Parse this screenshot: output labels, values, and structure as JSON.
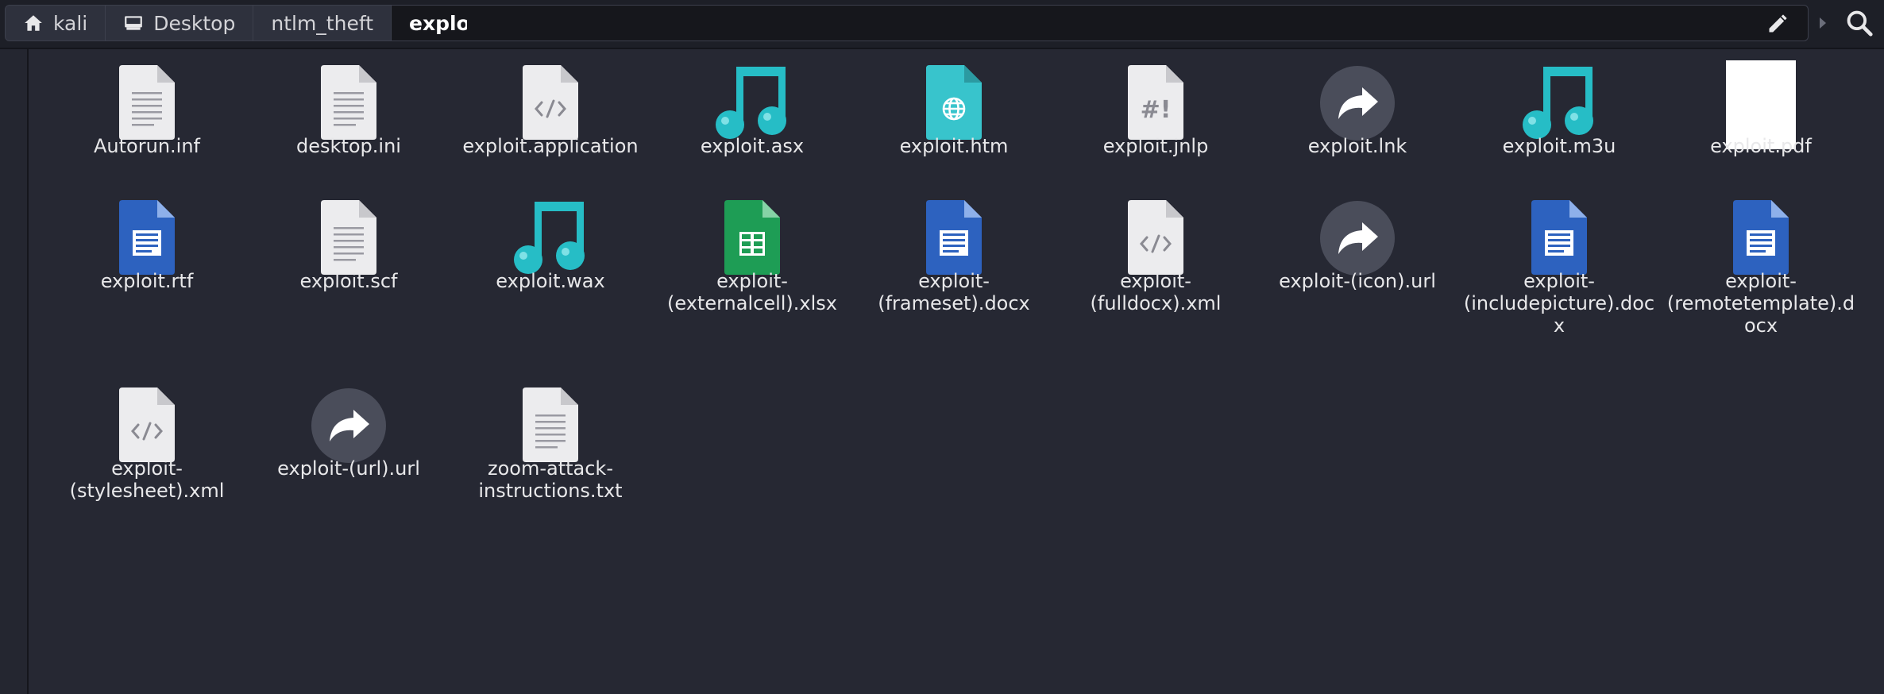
{
  "breadcrumbs": [
    {
      "label": "kali",
      "icon": "home-icon"
    },
    {
      "label": "Desktop",
      "icon": "desktop-icon"
    },
    {
      "label": "ntlm_theft",
      "icon": ""
    },
    {
      "label": "exploit",
      "icon": ""
    }
  ],
  "toolbar": {
    "edit_icon": "pencil-icon",
    "forward_icon": "chevron-right-icon",
    "search_icon": "search-icon"
  },
  "files": [
    {
      "name": "Autorun.inf",
      "label_lines": [
        "Autorun.inf"
      ],
      "icon": "text-file-icon"
    },
    {
      "name": "desktop.ini",
      "label_lines": [
        "desktop.ini"
      ],
      "icon": "text-file-icon"
    },
    {
      "name": "exploit.application",
      "label_lines": [
        "exploit.application"
      ],
      "icon": "code-file-icon"
    },
    {
      "name": "exploit.asx",
      "label_lines": [
        "exploit.asx"
      ],
      "icon": "music-note-icon"
    },
    {
      "name": "exploit.htm",
      "label_lines": [
        "exploit.htm"
      ],
      "icon": "html-file-icon"
    },
    {
      "name": "exploit.jnlp",
      "label_lines": [
        "exploit.jnlp"
      ],
      "icon": "script-file-icon"
    },
    {
      "name": "exploit.lnk",
      "label_lines": [
        "exploit.lnk"
      ],
      "icon": "shortcut-icon"
    },
    {
      "name": "exploit.m3u",
      "label_lines": [
        "exploit.m3u"
      ],
      "icon": "music-note-icon"
    },
    {
      "name": "exploit.pdf",
      "label_lines": [
        "exploit.pdf"
      ],
      "icon": "pdf-thumbnail-icon"
    },
    {
      "name": "exploit.rtf",
      "label_lines": [
        "exploit.rtf"
      ],
      "icon": "document-file-icon"
    },
    {
      "name": "exploit.scf",
      "label_lines": [
        "exploit.scf"
      ],
      "icon": "text-file-icon"
    },
    {
      "name": "exploit.wax",
      "label_lines": [
        "exploit.wax"
      ],
      "icon": "music-note-icon"
    },
    {
      "name": "exploit-(externalcell).xlsx",
      "label_lines": [
        "exploit-",
        "(externalcell).xlsx"
      ],
      "icon": "spreadsheet-file-icon"
    },
    {
      "name": "exploit-(frameset).docx",
      "label_lines": [
        "exploit-",
        "(frameset).docx"
      ],
      "icon": "document-file-icon"
    },
    {
      "name": "exploit-(fulldocx).xml",
      "label_lines": [
        "exploit-",
        "(fulldocx).xml"
      ],
      "icon": "code-file-icon"
    },
    {
      "name": "exploit-(icon).url",
      "label_lines": [
        "exploit-(icon).url"
      ],
      "icon": "shortcut-icon"
    },
    {
      "name": "exploit-(includepicture).docx",
      "label_lines": [
        "exploit-",
        "(includepicture).doc",
        "x"
      ],
      "icon": "document-file-icon"
    },
    {
      "name": "exploit-(remotetemplate).docx",
      "label_lines": [
        "exploit-",
        "(remotetemplate).d",
        "ocx"
      ],
      "icon": "document-file-icon"
    },
    {
      "name": "exploit-(stylesheet).xml",
      "label_lines": [
        "exploit-",
        "(stylesheet).xml"
      ],
      "icon": "code-file-icon"
    },
    {
      "name": "exploit-(url).url",
      "label_lines": [
        "exploit-(url).url"
      ],
      "icon": "shortcut-icon"
    },
    {
      "name": "zoom-attack-instructions.txt",
      "label_lines": [
        "zoom-attack-",
        "instructions.txt"
      ],
      "icon": "text-file-icon"
    }
  ],
  "colors": {
    "background": "#262833",
    "pathbar": "#1d1f27",
    "music_teal": "#26bdc6",
    "doc_blue": "#2d62bf",
    "sheet_green": "#1e9d55",
    "shortcut_gray": "#4a4d5a"
  }
}
